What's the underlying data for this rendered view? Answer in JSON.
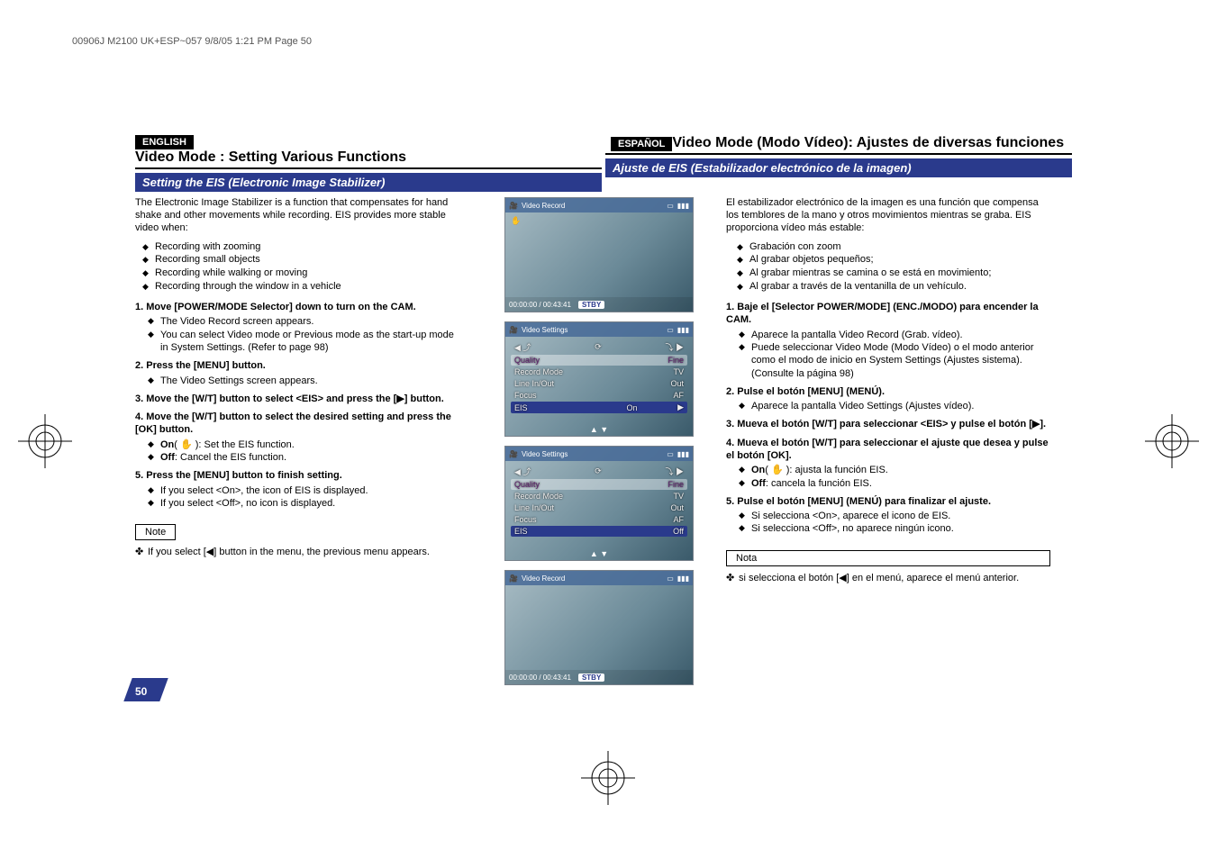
{
  "header_line": "00906J M2100 UK+ESP~057  9/8/05 1:21 PM  Page 50",
  "page_number": "50",
  "left": {
    "lang": "ENGLISH",
    "title": "Video Mode : Setting Various Functions",
    "section": "Setting the EIS (Electronic Image Stabilizer)",
    "intro": "The Electronic Image Stabilizer is a function that compensates for hand shake and other movements while recording. EIS provides more stable video when:",
    "intro_bullets": [
      "Recording with zooming",
      "Recording small objects",
      "Recording while walking or moving",
      "Recording through the window in a vehicle"
    ],
    "steps": [
      {
        "num": "1.",
        "title": "Move [POWER/MODE Selector] down to turn on the CAM.",
        "subs": [
          "The Video Record screen appears.",
          "You can select Video mode or Previous mode as the start-up mode in System Settings. (Refer to page 98)"
        ]
      },
      {
        "num": "2.",
        "title": "Press the [MENU] button.",
        "subs": [
          "The Video Settings screen appears."
        ]
      },
      {
        "num": "3.",
        "title": "Move the [W/T] button to select <EIS> and press the [▶] button.",
        "subs": []
      },
      {
        "num": "4.",
        "title": "Move the [W/T] button to select the desired setting and press the [OK] button.",
        "subs": [
          "On( ✋ ): Set the EIS function.",
          "Off: Cancel the EIS function."
        ]
      },
      {
        "num": "5.",
        "title": "Press the [MENU] button to finish setting.",
        "subs": [
          "If you select <On>, the icon of EIS is displayed.",
          "If you select <Off>, no icon is displayed."
        ]
      }
    ],
    "note_label": "Note",
    "note_text": "If you select [◀] button in the menu, the previous menu appears."
  },
  "right": {
    "lang": "ESPAÑOL",
    "title": "Video Mode (Modo Vídeo): Ajustes de diversas funciones",
    "section": "Ajuste de EIS (Estabilizador electrónico de la imagen)",
    "intro": "El estabilizador electrónico de la imagen es una función que compensa los temblores de la mano y otros movimientos mientras se graba. EIS proporciona vídeo más estable:",
    "intro_bullets": [
      "Grabación con zoom",
      "Al grabar objetos pequeños;",
      "Al grabar mientras se camina o se está en movimiento;",
      "Al grabar a través de la ventanilla de un vehículo."
    ],
    "steps": [
      {
        "num": "1.",
        "title": "Baje el [Selector POWER/MODE] (ENC./MODO) para encender la CAM.",
        "subs": [
          "Aparece la pantalla Video Record (Grab. vídeo).",
          "Puede seleccionar Video Mode (Modo Vídeo) o el modo anterior como el modo de inicio en System Settings (Ajustes sistema). (Consulte la página 98)"
        ]
      },
      {
        "num": "2.",
        "title": "Pulse el botón [MENU] (MENÚ).",
        "subs": [
          "Aparece la pantalla Video Settings (Ajustes vídeo)."
        ]
      },
      {
        "num": "3.",
        "title": "Mueva el botón [W/T] para seleccionar <EIS> y pulse el botón [▶].",
        "subs": []
      },
      {
        "num": "4.",
        "title": "Mueva el botón [W/T] para seleccionar el ajuste que desea y pulse el botón [OK].",
        "subs": [
          "On( ✋ ): ajusta la función EIS.",
          "Off: cancela la función EIS."
        ]
      },
      {
        "num": "5.",
        "title": "Pulse el botón [MENU] (MENÚ) para finalizar el ajuste.",
        "subs": [
          "Si selecciona <On>, aparece el icono de EIS.",
          "Si selecciona <Off>, no aparece ningún icono."
        ]
      }
    ],
    "note_label": "Nota",
    "note_text": "si selecciona el botón [◀] en el menú, aparece el menú anterior."
  },
  "shots": {
    "s1": {
      "num": "1",
      "top": "Video Record",
      "bl": "00:00:00 / 00:43:41",
      "stby": "STBY"
    },
    "s3": {
      "num": "3",
      "top": "Video Settings",
      "rows": [
        {
          "lbl": "Quality",
          "val": "Fine",
          "cls": "quality-row"
        },
        {
          "lbl": "Record Mode",
          "val": "TV",
          "cls": ""
        },
        {
          "lbl": "Line In/Out",
          "val": "Out",
          "cls": ""
        },
        {
          "lbl": "Focus",
          "val": "AF",
          "cls": ""
        },
        {
          "lbl": "EIS",
          "val": "On",
          "cls": "sel"
        }
      ]
    },
    "s4": {
      "num": "4",
      "top": "Video Settings",
      "rows": [
        {
          "lbl": "Quality",
          "val": "Fine",
          "cls": "quality-row"
        },
        {
          "lbl": "Record Mode",
          "val": "TV",
          "cls": ""
        },
        {
          "lbl": "Line In/Out",
          "val": "Out",
          "cls": ""
        },
        {
          "lbl": "Focus",
          "val": "AF",
          "cls": ""
        },
        {
          "lbl": "EIS",
          "val": "Off",
          "cls": "sel"
        }
      ]
    },
    "s5": {
      "num": "5",
      "top": "Video Record",
      "bl": "00:00:00 / 00:43:41",
      "stby": "STBY"
    }
  }
}
